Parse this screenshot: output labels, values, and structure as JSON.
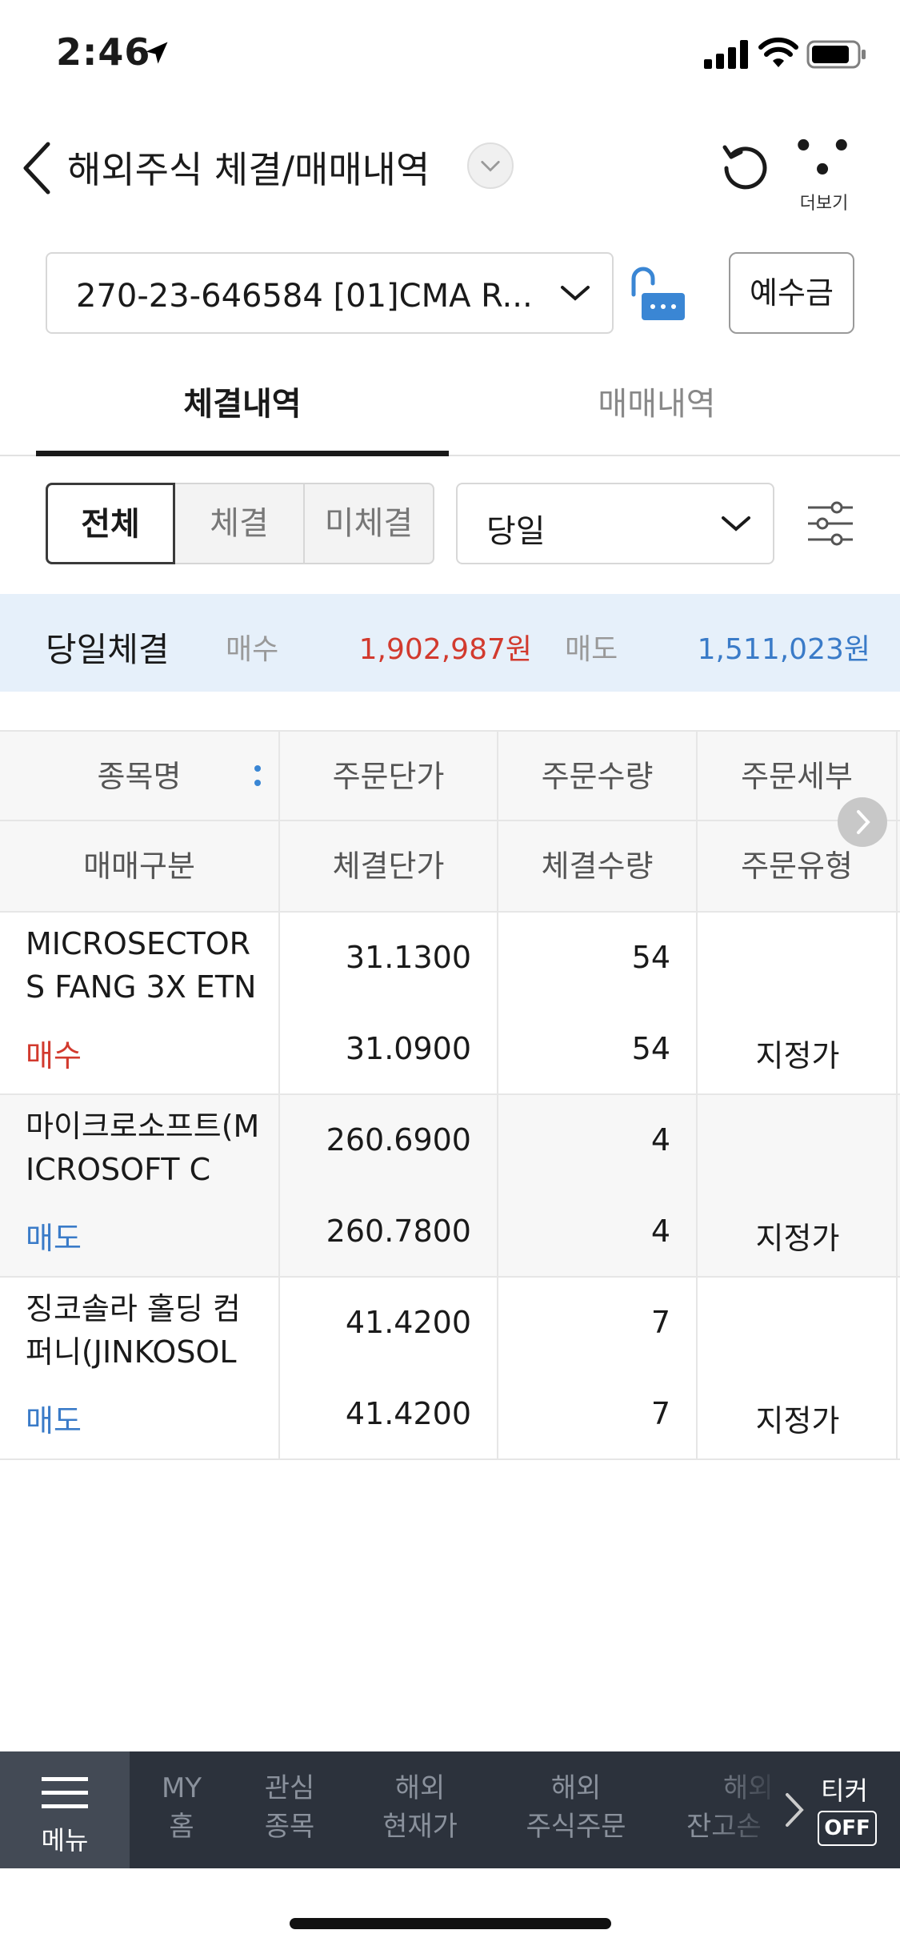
{
  "status_bar": {
    "time": "2:46"
  },
  "header": {
    "title": "해외주식 체결/매매내역",
    "more_label": "더보기"
  },
  "account": {
    "number": "270-23-646584 [01]CMA R...",
    "deposit_label": "예수금"
  },
  "tabs": [
    {
      "label": "체결내역",
      "active": true
    },
    {
      "label": "매매내역",
      "active": false
    }
  ],
  "filters": {
    "segments": [
      "전체",
      "체결",
      "미체결"
    ],
    "selected_segment": "전체",
    "period": "당일"
  },
  "summary": {
    "title": "당일체결",
    "buy_label": "매수",
    "buy_amount": "1,902,987원",
    "sell_label": "매도",
    "sell_amount": "1,511,023원"
  },
  "table": {
    "headers_row1": [
      "종목명",
      "주문단가",
      "주문수량",
      "주문세부"
    ],
    "headers_row2": [
      "매매구분",
      "체결단가",
      "체결수량",
      "주문유형"
    ],
    "rows": [
      {
        "name": "MICROSECTORS FANG 3X ETN",
        "side": "매수",
        "order_price": "31.1300",
        "order_qty": "54",
        "detail": "",
        "exec_price": "31.0900",
        "exec_qty": "54",
        "order_type": "지정가"
      },
      {
        "name": "마이크로소프트(MICROSOFT C",
        "side": "매도",
        "order_price": "260.6900",
        "order_qty": "4",
        "detail": "",
        "exec_price": "260.7800",
        "exec_qty": "4",
        "order_type": "지정가"
      },
      {
        "name": "징코솔라 홀딩 컴퍼니(JINKOSOL",
        "side": "매도",
        "order_price": "41.4200",
        "order_qty": "7",
        "detail": "",
        "exec_price": "41.4200",
        "exec_qty": "7",
        "order_type": "지정가"
      }
    ]
  },
  "bottom_nav": {
    "menu_label": "메뉴",
    "items": [
      {
        "line1": "MY",
        "line2": "홈"
      },
      {
        "line1": "관심",
        "line2": "종목"
      },
      {
        "line1": "해외",
        "line2": "현재가"
      },
      {
        "line1": "해외",
        "line2": "주식주문"
      },
      {
        "line1": "해외",
        "line2": "잔고손"
      }
    ],
    "ticker_label": "티커",
    "ticker_state": "OFF"
  },
  "colors": {
    "buy": "#d23a2e",
    "sell": "#3a7bc8",
    "summary_bg": "#e6f0fa",
    "nav_bg": "#2c323c"
  }
}
